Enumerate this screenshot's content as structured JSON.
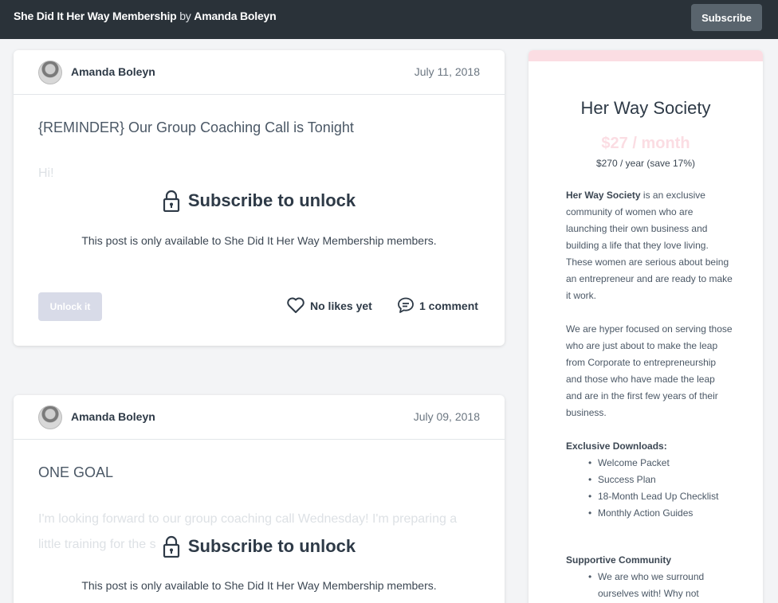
{
  "header": {
    "brand": "She Did It Her Way Membership",
    "by": " by ",
    "author": "Amanda Boleyn",
    "subscribe_label": "Subscribe"
  },
  "posts": [
    {
      "author": "Amanda Boleyn",
      "date": "July 11, 2018",
      "title": "{REMINDER} Our Group Coaching Call is Tonight",
      "teaser": "Hi!",
      "lock_label": "Subscribe to unlock",
      "availability": "This post is only available to She Did It Her Way Membership members.",
      "unlock_label": "Unlock it",
      "likes_label": "No likes yet",
      "comments_label": "1 comment"
    },
    {
      "author": "Amanda Boleyn",
      "date": "July 09, 2018",
      "title": "ONE GOAL",
      "teaser": "I'm looking forward to our group coaching call Wednesday! I'm preparing a little training for the s",
      "lock_label": "Subscribe to unlock",
      "availability": "This post is only available to She Did It Her Way Membership members."
    }
  ],
  "sidebar": {
    "name": "Her Way Society",
    "price": "$27 / month",
    "yearly": "$270 / year (save 17%)",
    "intro_bold": "Her Way Society",
    "intro_rest": " is an exclusive community of women who are launching their own business and building a life that they love living. These women are serious about being an entrepreneur and are ready to make it work.",
    "para2": "We are hyper focused on serving those who are just about to make the leap from Corporate to entrepreneurship and those who have made the leap and are in the first few years of their business.",
    "downloads_heading": "Exclusive Downloads:",
    "downloads": [
      "Welcome Packet",
      "Success Plan",
      "18-Month Lead Up Checklist",
      "Monthly Action Guides"
    ],
    "community_heading": "Supportive Community",
    "community_items": [
      "We are who we surround ourselves with! Why not"
    ]
  },
  "colors": {
    "topbar": "#2a3239",
    "accent_pink": "#fbdde3",
    "unlock_button": "#d8dbe8"
  },
  "icons": [
    "lock-icon",
    "heart-icon",
    "comment-icon",
    "avatar"
  ]
}
